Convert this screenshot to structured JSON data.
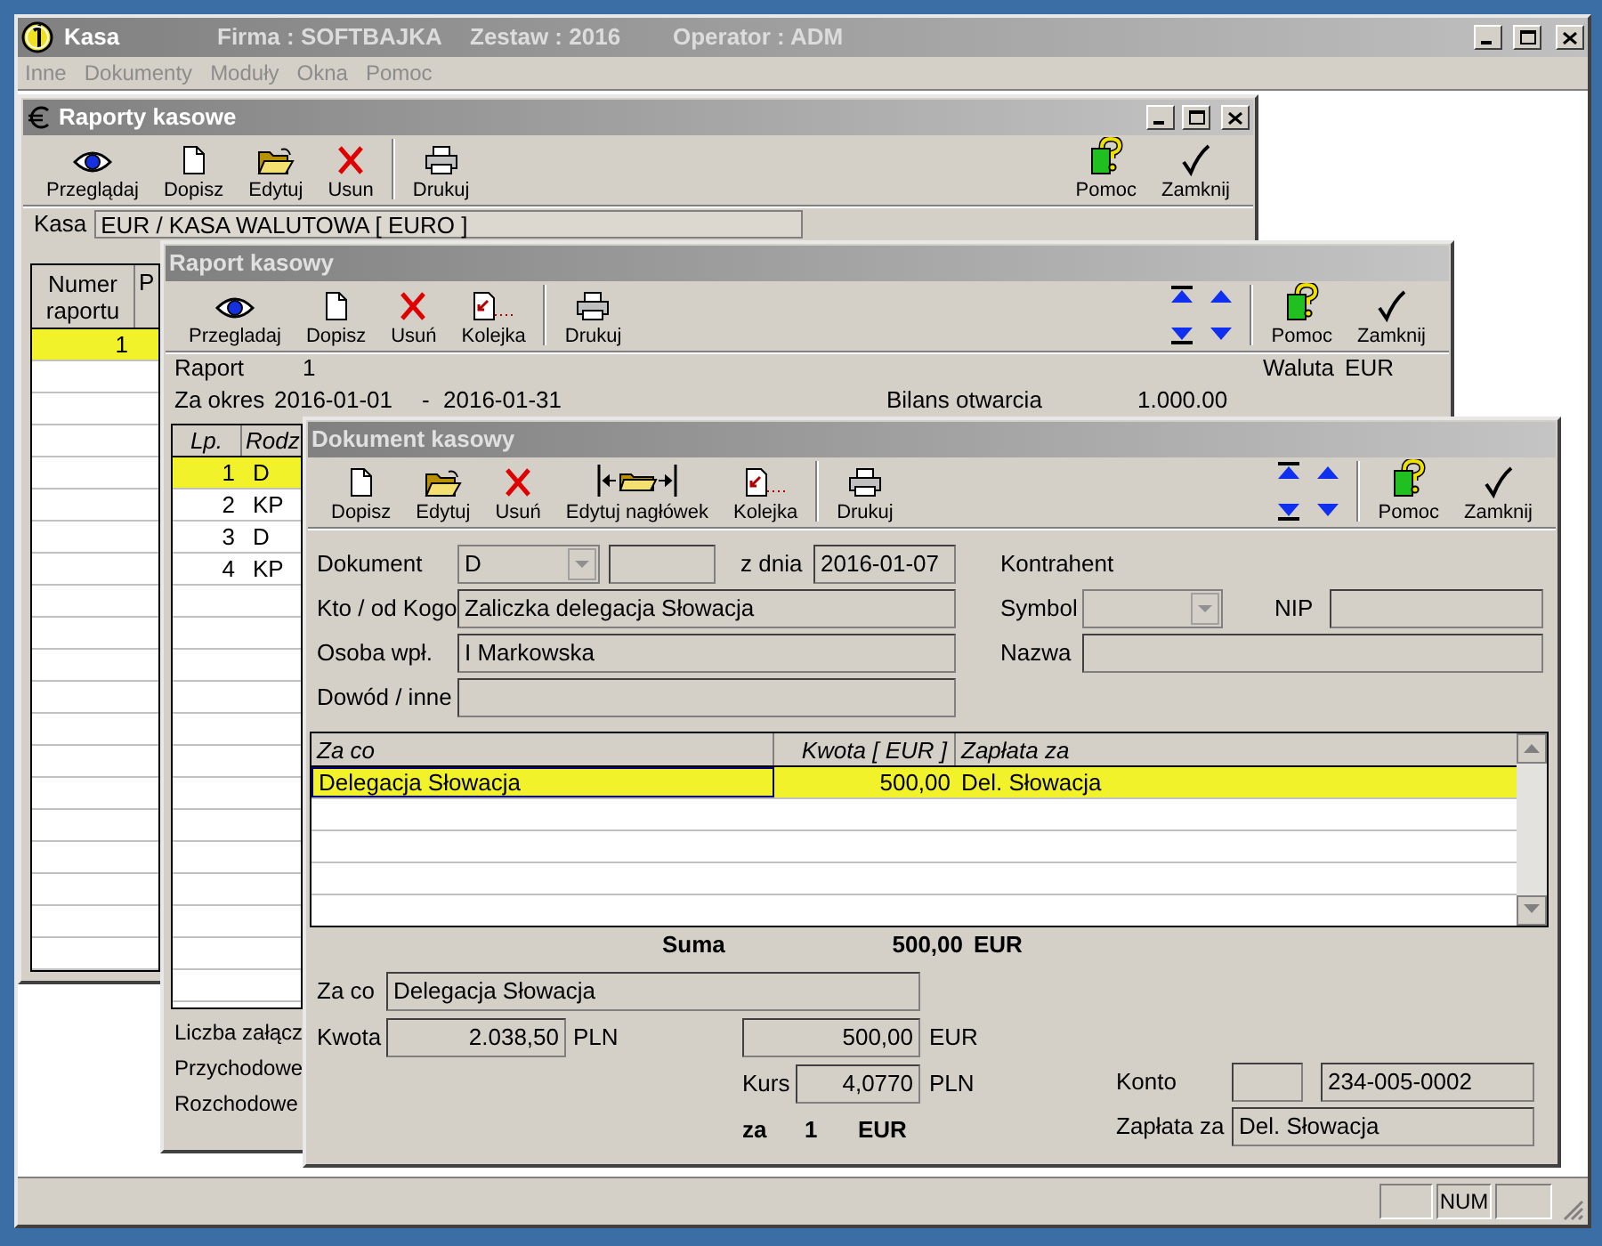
{
  "window": {
    "title": "Kasa",
    "info": [
      "Firma : SOFTBAJKA",
      "Zestaw : 2016",
      "Operator : ADM"
    ]
  },
  "menu": [
    {
      "label": "Inne",
      "disabled": true
    },
    {
      "label": "Dokumenty",
      "disabled": true
    },
    {
      "label": "Moduły",
      "disabled": true
    },
    {
      "label": "Okna",
      "disabled": true
    },
    {
      "label": "Pomoc",
      "disabled": true
    }
  ],
  "raporty_kasowe": {
    "title": "Raporty kasowe",
    "toolbar_left": [
      {
        "kind": "view",
        "label": "Przeglądaj"
      },
      {
        "kind": "new",
        "label": "Dopisz"
      },
      {
        "kind": "edit",
        "label": "Edytuj"
      },
      {
        "kind": "delete",
        "label": "Usun"
      },
      {
        "kind": "separator"
      },
      {
        "kind": "print",
        "label": "Drukuj"
      }
    ],
    "toolbar_right": [
      {
        "kind": "help",
        "label": "Pomoc"
      },
      {
        "kind": "close",
        "label": "Zamknij"
      }
    ],
    "kasa_label": "Kasa",
    "kasa_value": "EUR / KASA WALUTOWA [ EURO ]",
    "columns": [
      "Numer raportu",
      "P"
    ],
    "rows": [
      {
        "cells": [
          "1"
        ],
        "selected": true
      }
    ]
  },
  "raport_kasowy": {
    "title": "Raport kasowy",
    "toolbar_left": [
      {
        "kind": "view",
        "label": "Przegladaj"
      },
      {
        "kind": "new",
        "label": "Dopisz"
      },
      {
        "kind": "delete",
        "label": "Usuń"
      },
      {
        "kind": "queue",
        "label": "Kolejka"
      },
      {
        "kind": "separator"
      },
      {
        "kind": "print",
        "label": "Drukuj"
      }
    ],
    "toolbar_right": [
      {
        "kind": "nav"
      },
      {
        "kind": "separator"
      },
      {
        "kind": "help",
        "label": "Pomoc"
      },
      {
        "kind": "close",
        "label": "Zamknij"
      }
    ],
    "raport_label": "Raport",
    "raport_value": "1",
    "waluta_label": "Waluta",
    "waluta_value": "EUR",
    "okres_label": "Za okres",
    "okres_from": "2016-01-01",
    "okres_dash": "-",
    "okres_to": "2016-01-31",
    "bilans_label": "Bilans otwarcia",
    "bilans_value": "1.000.00",
    "columns": [
      "Lp.",
      "Rodz"
    ],
    "rows": [
      {
        "cells": [
          "1",
          "D"
        ],
        "selected": true
      },
      {
        "cells": [
          "2",
          "KP"
        ],
        "selected": false
      },
      {
        "cells": [
          "3",
          "D"
        ],
        "selected": false
      },
      {
        "cells": [
          "4",
          "KP"
        ],
        "selected": false
      }
    ],
    "footer": [
      "Liczba załącz",
      "Przychodowe",
      "Rozchodowe"
    ]
  },
  "dokument_kasowy": {
    "title": "Dokument kasowy",
    "toolbar_left": [
      {
        "kind": "new",
        "label": "Dopisz"
      },
      {
        "kind": "edit",
        "label": "Edytuj"
      },
      {
        "kind": "delete",
        "label": "Usuń"
      },
      {
        "kind": "header",
        "label": "Edytuj nagłówek"
      },
      {
        "kind": "queue",
        "label": "Kolejka"
      },
      {
        "kind": "separator"
      },
      {
        "kind": "print",
        "label": "Drukuj"
      }
    ],
    "toolbar_right": [
      {
        "kind": "nav"
      },
      {
        "kind": "separator"
      },
      {
        "kind": "help",
        "label": "Pomoc"
      },
      {
        "kind": "close",
        "label": "Zamknij"
      }
    ],
    "dokument_label": "Dokument",
    "dokument_value": "D",
    "z_dnia_label": "z dnia",
    "date": "2016-01-07",
    "kto_label": "Kto / od Kogo",
    "kto_value": "Zaliczka delegacja Słowacja",
    "osoba_label": "Osoba wpł.",
    "osoba_value": "I Markowska",
    "dowod_label": "Dowód / inne",
    "kontrahent_label": "Kontrahent",
    "symbol_label": "Symbol",
    "nip_label": "NIP",
    "nazwa_label": "Nazwa",
    "columns": [
      "Za co",
      "Kwota [ EUR ]",
      "Zapłata za"
    ],
    "rows": [
      {
        "cells": [
          "Delegacja Słowacja",
          "500,00",
          "Del. Słowacja"
        ],
        "selected": true
      }
    ],
    "suma_label": "Suma",
    "suma_value": "500,00",
    "suma_currency": "EUR",
    "za_co_label": "Za co",
    "za_co_value": "Delegacja Słowacja",
    "kwota_label": "Kwota",
    "kwota_pln": "2.038,50",
    "kwota_pln_currency": "PLN",
    "kwota_eur": "500,00",
    "kwota_eur_currency": "EUR",
    "kurs_label": "Kurs",
    "kurs_value": "4,0770",
    "kurs_currency": "PLN",
    "za_label": "za",
    "za_qty": "1",
    "za_currency": "EUR",
    "konto_label": "Konto",
    "konto_value": "234-005-0002",
    "zaplata_label": "Zapłata za",
    "zaplata_value": "Del. Słowacja"
  },
  "status_bar": {
    "indicator": "NUM"
  }
}
